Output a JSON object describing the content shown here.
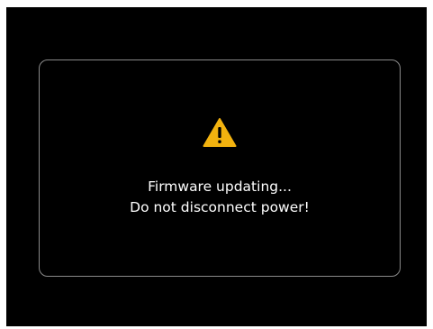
{
  "dialog": {
    "icon": "warning-icon",
    "line1": "Firmware updating...",
    "line2": "Do not disconnect power!"
  },
  "colors": {
    "background": "#000000",
    "border": "#8a8a8a",
    "text": "#ffffff",
    "warning": "#f2b20f"
  }
}
